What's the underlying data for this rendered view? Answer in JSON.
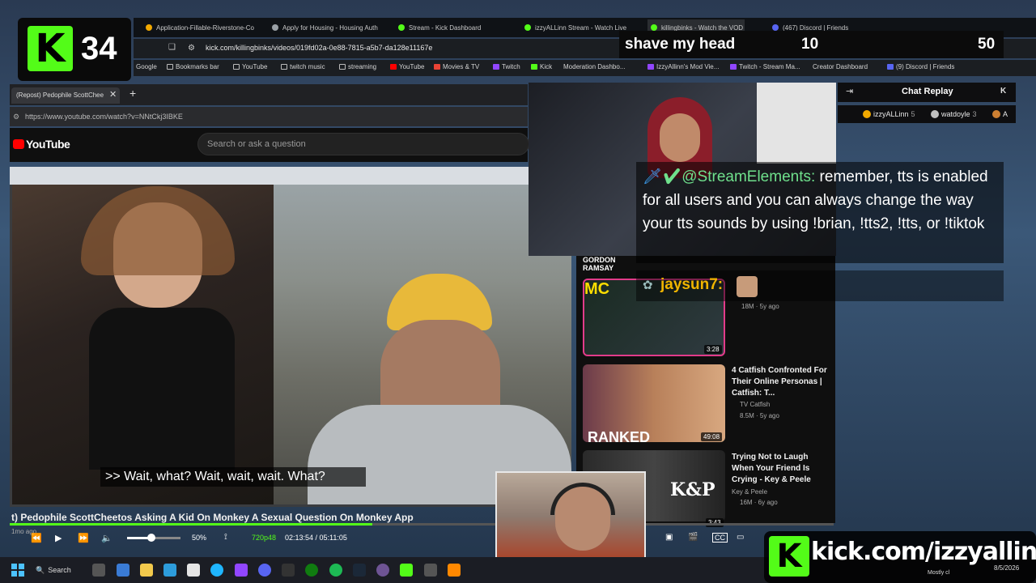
{
  "kick_counter": {
    "logo": "K",
    "count": "34"
  },
  "goal": {
    "title": "shave my head",
    "current": "10",
    "target": "50"
  },
  "browser": {
    "tabs": [
      {
        "label": "Application-Fillable-Riverstone-Co",
        "color": "#f2a900"
      },
      {
        "label": "Apply for Housing - Housing Auth",
        "color": "#9aa0a6"
      },
      {
        "label": "Stream - Kick Dashboard",
        "color": "#53fc18"
      },
      {
        "label": "izzyALLinn Stream - Watch Live",
        "color": "#53fc18"
      },
      {
        "label": "killingbinks - Watch the VOD",
        "color": "#53fc18"
      },
      {
        "label": "(467) Discord | Friends",
        "color": "#5865f2"
      }
    ],
    "url": "kick.com/killingbinks/videos/019fd02a-0e88-7815-a5b7-da128e11167e",
    "bookmarks": [
      "Google",
      "Bookmarks bar",
      "YouTube",
      "twitch music",
      "streaming",
      "YouTube",
      "Movies & TV",
      "Twitch",
      "Kick",
      "Moderation Dashbo...",
      "IzzyAllinn's Mod Vie...",
      "Twitch - Stream Ma...",
      "Creator Dashboard",
      "(9) Discord | Friends"
    ]
  },
  "inner_browser": {
    "tab_label": "(Repost) Pedophile ScottChee",
    "url": "https://www.youtube.com/watch?v=NNtCkj3IBKE",
    "youtube_word": "YouTube",
    "search_placeholder": "Search or ask a question"
  },
  "video": {
    "caption": ">> Wait, what? Wait, wait, wait. What?",
    "title": "t) Pedophile ScottCheetos Asking A Kid On Monkey A Sexual Question On Monkey App",
    "age": "1mo ago",
    "progress_fraction": 0.44,
    "volume_fraction": 0.45,
    "speed": "50%",
    "quality": "720p48",
    "time": "02:13:54 / 05:11:05"
  },
  "chat_replay": {
    "title": "Chat Replay",
    "top_users": [
      {
        "name": "izzyALLinn",
        "count": "5",
        "color": "#f2a900"
      },
      {
        "name": "watdoyle",
        "count": "3",
        "color": "#c0c0c0"
      },
      {
        "name": "A",
        "count": "",
        "color": "#cd7f32"
      }
    ]
  },
  "overlay_chat": {
    "user1": "@StreamElements:",
    "message1": " remember, tts is enabled for all users and you can always change the way your tts sounds by using !brian, !tts2, !tts, or !tiktok",
    "user2": "jaysun7:"
  },
  "recommendations": [
    {
      "title": "",
      "meta1": "",
      "meta2": "",
      "duration": "3:28",
      "brand": "GORDON RAMSAY"
    },
    {
      "title": "4 Catfish Confronted For Their Online Personas | Catfish: T...",
      "meta1": "TV Catfish",
      "meta2": "8.5M · 5y ago",
      "duration": "49:08",
      "brand": "RANKED"
    },
    {
      "title": "Trying Not to Laugh When Your Friend Is Crying - Key & Peele",
      "meta1": "Key & Peele",
      "meta2": "16M · 6y ago",
      "duration": "3:43",
      "brand": "K&P"
    }
  ],
  "rec_meta_top": "18M · 5y ago",
  "kick_banner": {
    "logo": "K",
    "text": "kick.com/izzyallinn"
  },
  "taskbar": {
    "search": "Search",
    "clock_time": "",
    "clock_date": "8/5/2026",
    "weather": "Mostly cl"
  },
  "colors": {
    "kick_green": "#53fc18",
    "streamelements_green": "#6fe08c",
    "jaysun_gold": "#f0b400"
  }
}
